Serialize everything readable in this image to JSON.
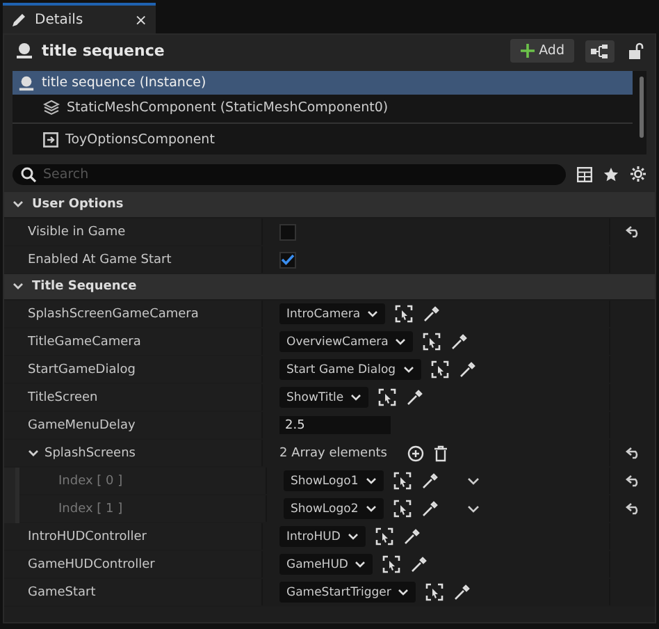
{
  "tab": {
    "label": "Details",
    "close": "×"
  },
  "header": {
    "title": "title sequence",
    "add_label": "Add"
  },
  "components": [
    {
      "label": "title sequence (Instance)",
      "kind": "actor",
      "selected": true,
      "indent": false
    },
    {
      "label": "StaticMeshComponent (StaticMeshComponent0)",
      "kind": "mesh",
      "selected": false,
      "indent": true
    },
    {
      "label": "ToyOptionsComponent",
      "kind": "component",
      "selected": false,
      "indent": true
    }
  ],
  "search": {
    "placeholder": "Search"
  },
  "categories": [
    {
      "title": "User Options",
      "expanded": true,
      "properties": [
        {
          "label": "Visible in Game",
          "kind": "checkbox",
          "checked": false,
          "reset": true
        },
        {
          "label": "Enabled At Game Start",
          "kind": "checkbox",
          "checked": true,
          "reset": false
        }
      ]
    },
    {
      "title": "Title Sequence",
      "expanded": true,
      "properties": [
        {
          "label": "SplashScreenGameCamera",
          "kind": "dropdown",
          "value": "IntroCamera",
          "reset": false
        },
        {
          "label": "TitleGameCamera",
          "kind": "dropdown",
          "value": "OverviewCamera",
          "reset": false
        },
        {
          "label": "StartGameDialog",
          "kind": "dropdown",
          "value": "Start Game Dialog",
          "reset": false
        },
        {
          "label": "TitleScreen",
          "kind": "dropdown",
          "value": "ShowTitle",
          "reset": false
        },
        {
          "label": "GameMenuDelay",
          "kind": "number",
          "value": "2.5",
          "reset": false
        },
        {
          "label": "SplashScreens",
          "kind": "array",
          "value": "2 Array elements",
          "reset": true,
          "expanded": true,
          "children": [
            {
              "label": "Index [ 0 ]",
              "kind": "dropdown",
              "value": "ShowLogo1",
              "reset": true
            },
            {
              "label": "Index [ 1 ]",
              "kind": "dropdown",
              "value": "ShowLogo2",
              "reset": true
            }
          ]
        },
        {
          "label": "IntroHUDController",
          "kind": "dropdown",
          "value": "IntroHUD",
          "reset": false
        },
        {
          "label": "GameHUDController",
          "kind": "dropdown",
          "value": "GameHUD",
          "reset": false
        },
        {
          "label": "GameStart",
          "kind": "dropdown",
          "value": "GameStartTrigger",
          "reset": false
        }
      ]
    }
  ]
}
